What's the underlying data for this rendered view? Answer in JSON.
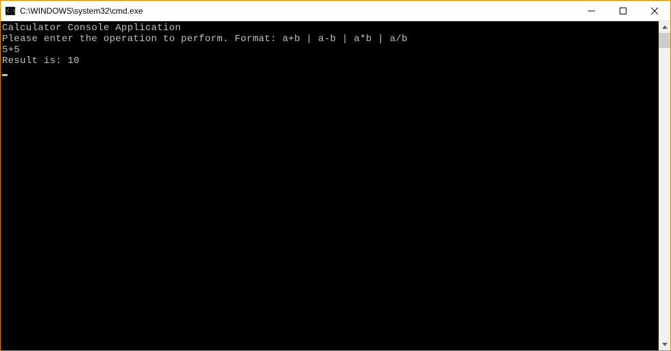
{
  "titlebar": {
    "title": "C:\\WINDOWS\\system32\\cmd.exe"
  },
  "console": {
    "lines": [
      "Calculator Console Application",
      "",
      "Please enter the operation to perform. Format: a+b | a-b | a*b | a/b",
      "5+5",
      "Result is: 10"
    ]
  }
}
